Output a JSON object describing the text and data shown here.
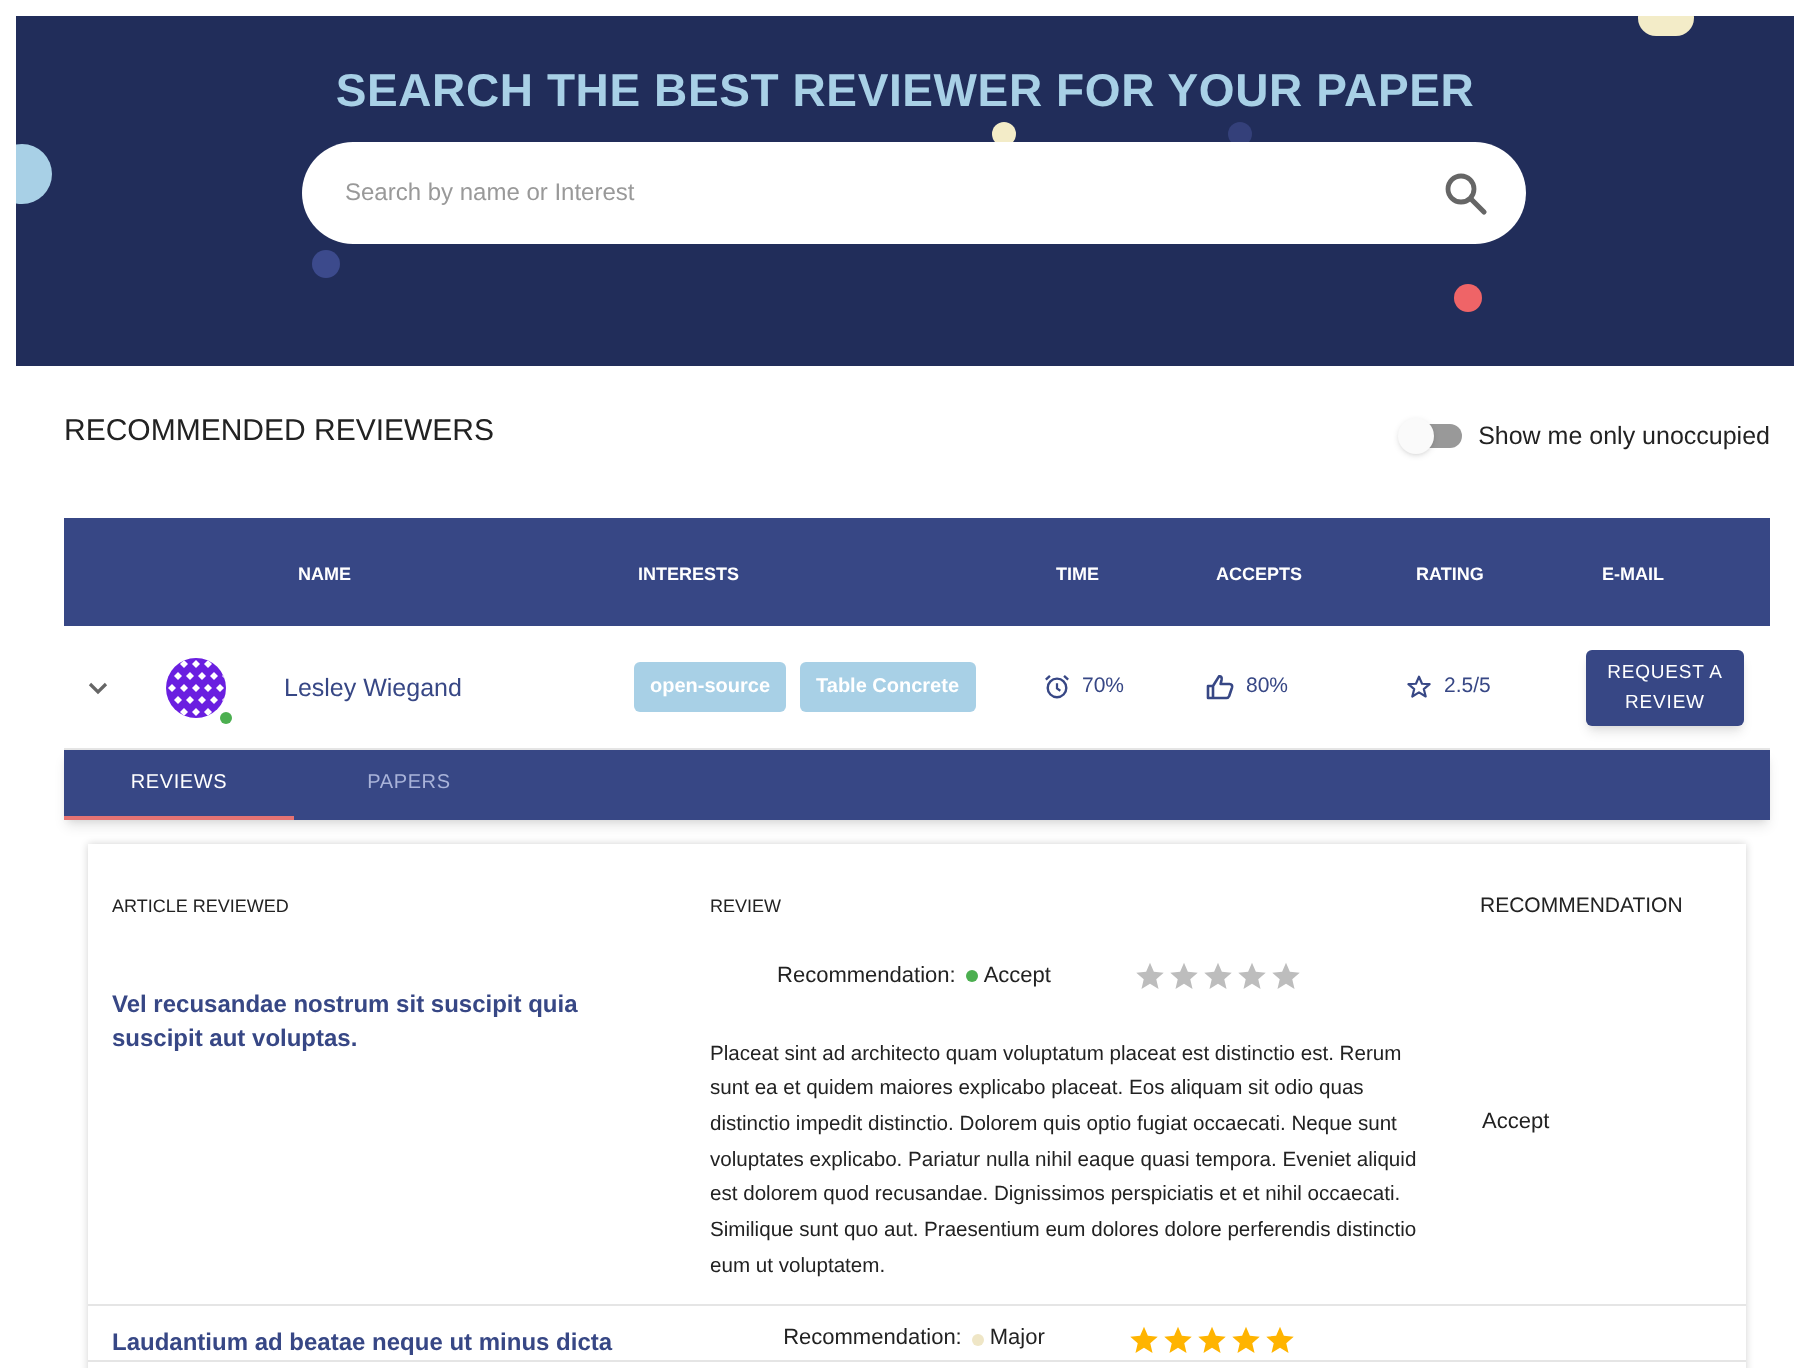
{
  "header": {
    "title": "SEARCH THE BEST REVIEWER FOR YOUR PAPER",
    "search": {
      "placeholder": "Search by name or Interest"
    }
  },
  "section": {
    "title": "RECOMMENDED REVIEWERS",
    "filter": {
      "label": "Show me only unoccupied",
      "on": false
    }
  },
  "table": {
    "columns": [
      "NAME",
      "INTERESTS",
      "TIME",
      "ACCEPTS",
      "RATING",
      "E-MAIL"
    ],
    "rows": [
      {
        "expanded": true,
        "online": true,
        "name": "Lesley Wiegand",
        "interests": [
          "open-source",
          "Table Concrete"
        ],
        "time": "70%",
        "accepts": "80%",
        "rating": "2.5/5",
        "action": "REQUEST A REVIEW"
      }
    ]
  },
  "detail_tabs": [
    {
      "label": "REVIEWS",
      "selected": true
    },
    {
      "label": "PAPERS",
      "selected": false
    }
  ],
  "reviews": {
    "columns": [
      "ARTICLE REVIEWED",
      "REVIEW",
      "RECOMMENDATION"
    ],
    "rows": [
      {
        "article": "Vel recusandae nostrum sit suscipit quia suscipit aut voluptas.",
        "recommendation_label": "Recommendation:",
        "recommendation": "Accept",
        "color": "#4caf50",
        "stars": 0,
        "text": "Placeat sint ad architecto quam voluptatum placeat est distinctio est. Rerum sunt ea et quidem maiores explicabo placeat. Eos aliquam sit odio quas distinctio impedit distinctio. Dolorem quis optio fugiat occaecati. Neque sunt voluptates explicabo. Pariatur nulla nihil eaque quasi tempora. Eveniet aliquid est dolorem quod recusandae. Dignissimos perspiciatis et et nihil occaecati. Similique sunt quo aut. Praesentium eum dolores dolore perferendis distinctio eum ut voluptatem.",
        "final": "Accept"
      },
      {
        "article": "Laudantium ad beatae neque ut minus dicta",
        "recommendation_label": "Recommendation:",
        "recommendation": "Major",
        "color": "#efe6c6",
        "stars": 5
      }
    ]
  }
}
